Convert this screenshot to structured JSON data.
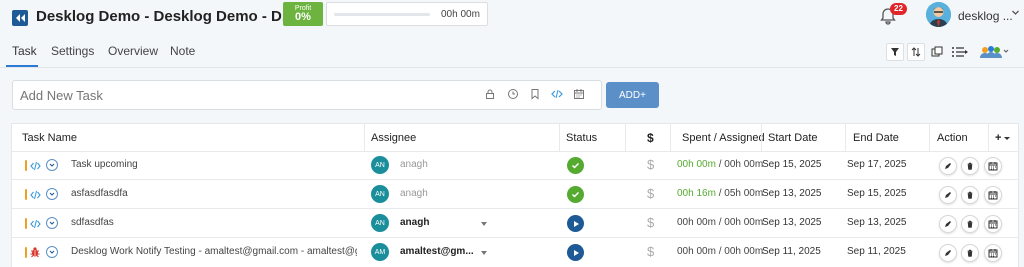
{
  "header": {
    "title": "Desklog Demo - Desklog Demo - D...",
    "profit_label": "Profit",
    "profit_value": "0%",
    "time_total": "00h 00m",
    "progress_fraction": 0,
    "notification_count": "22",
    "user_name": "desklog ..."
  },
  "tabs": [
    {
      "label": "Task",
      "active": true
    },
    {
      "label": "Settings",
      "active": false
    },
    {
      "label": "Overview",
      "active": false
    },
    {
      "label": "Note",
      "active": false
    }
  ],
  "add_task": {
    "placeholder": "Add New Task",
    "add_button_label": "ADD+"
  },
  "table": {
    "columns": [
      "Task Name",
      "Assignee",
      "Status",
      "$",
      "Spent / Assigned",
      "Start Date",
      "End Date",
      "Action",
      "+"
    ],
    "rows": [
      {
        "type": "code",
        "name": "Task upcoming",
        "assignee_initials": "AN",
        "assignee": "anagh",
        "assignee_muted": true,
        "has_dropdown": false,
        "status": "completed",
        "dollar": "$",
        "spent": "00h 00m",
        "assigned": "00h 00m",
        "spent_highlight": true,
        "start": "Sep 15, 2025",
        "end": "Sep 17, 2025"
      },
      {
        "type": "code",
        "name": "asfasdfasdfa",
        "assignee_initials": "AN",
        "assignee": "anagh",
        "assignee_muted": true,
        "has_dropdown": false,
        "status": "completed",
        "dollar": "$",
        "spent": "00h 16m",
        "assigned": "05h 00m",
        "spent_highlight": true,
        "start": "Sep 13, 2025",
        "end": "Sep 15, 2025"
      },
      {
        "type": "code",
        "name": "sdfasdfas",
        "assignee_initials": "AN",
        "assignee": "anagh",
        "assignee_muted": false,
        "has_dropdown": true,
        "status": "play",
        "dollar": "$",
        "spent": "00h 00m",
        "assigned": "00h 00m",
        "spent_highlight": false,
        "start": "Sep 13, 2025",
        "end": "Sep 13, 2025"
      },
      {
        "type": "bug",
        "name": "Desklog Work Notify Testing - amaltest@gmail.com - amaltest@gmail.c",
        "assignee_initials": "AM",
        "assignee": "amaltest@gm...",
        "assignee_muted": false,
        "has_dropdown": true,
        "status": "play",
        "dollar": "$",
        "spent": "00h 00m",
        "assigned": "00h 00m",
        "spent_highlight": false,
        "start": "Sep 11, 2025",
        "end": "Sep 11, 2025"
      }
    ]
  },
  "colors": {
    "brand": "#1e5a96",
    "profit": "#6db33f",
    "accent": "#5b8fc7",
    "badge": "#e0262b",
    "success": "#55aa30"
  },
  "icons": [
    "back-icon",
    "bell-icon",
    "filter-icon",
    "sort-icon",
    "copy-icon",
    "list-icon",
    "team-icon",
    "lock-icon",
    "clock-icon",
    "bookmark-icon",
    "code-icon",
    "calendar-icon",
    "bug-icon",
    "check-icon",
    "play-icon",
    "edit-icon",
    "delete-icon",
    "schedule-icon"
  ]
}
